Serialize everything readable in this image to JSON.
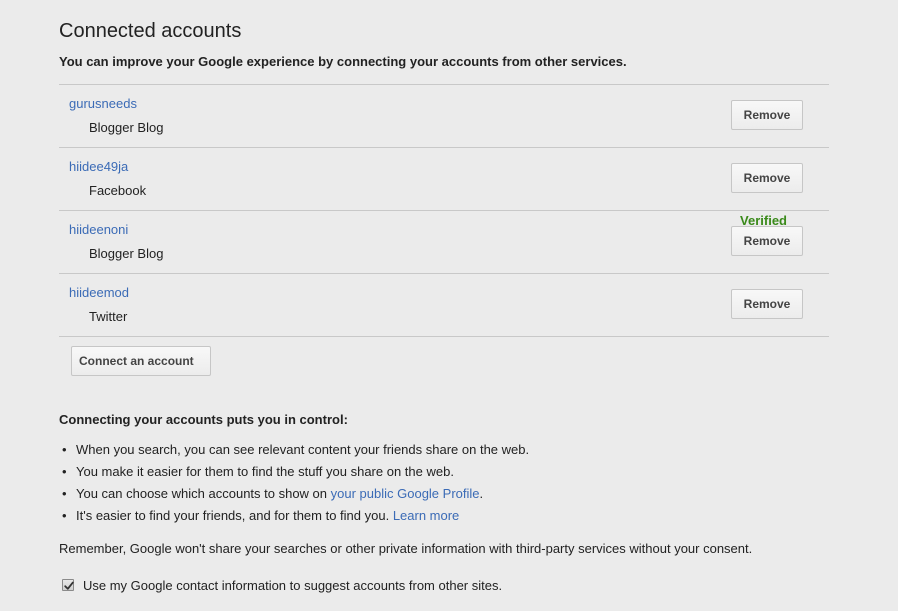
{
  "page": {
    "title": "Connected accounts",
    "subtitle": "You can improve your Google experience by connecting your accounts from other services."
  },
  "accounts": [
    {
      "username": "gurusneeds",
      "service": "Blogger Blog",
      "remove_label": "Remove"
    },
    {
      "username": "hiidee49ja",
      "service": "Facebook",
      "remove_label": "Remove"
    },
    {
      "username": "hiideenoni",
      "service": "Blogger Blog",
      "remove_label": "Remove"
    },
    {
      "username": "hiideemod",
      "service": "Twitter",
      "remove_label": "Remove",
      "status": "Verified"
    }
  ],
  "connect_button_label": "Connect an account",
  "control": {
    "heading": "Connecting your accounts puts you in control:",
    "bullet": "•",
    "items": [
      {
        "text": "When you search, you can see relevant content your friends share on the web."
      },
      {
        "text": "You make it easier for them to find the stuff you share on the web."
      },
      {
        "text": "You can choose which accounts to show on ",
        "link": "your public Google Profile",
        "suffix": "."
      },
      {
        "text": "It's easier to find your friends, and for them to find you. ",
        "link": "Learn more"
      }
    ]
  },
  "remember_text": "Remember, Google won't share your searches or other private information with third-party services without your consent.",
  "suggest_checkbox": {
    "checked": true,
    "label": "Use my Google contact information to suggest accounts from other sites."
  },
  "colors": {
    "background": "#ebebeb",
    "link": "#3b6bb6",
    "verified": "#3a8a1a",
    "divider": "#c8c8c8"
  }
}
